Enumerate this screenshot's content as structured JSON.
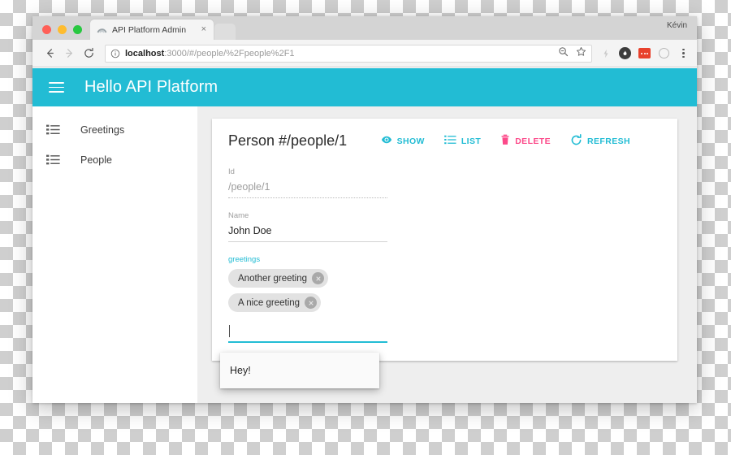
{
  "browser": {
    "profile_name": "Kévin",
    "tab": {
      "title": "API Platform Admin",
      "close_label": "×",
      "favicon": "rainbow-arc-icon"
    },
    "nav": {
      "back": "back-arrow-icon",
      "forward": "forward-arrow-icon",
      "reload": "reload-icon"
    },
    "omnibox": {
      "info_icon": "info-circle-icon",
      "host": "localhost",
      "path": ":3000/#/people/%2Fpeople%2F1",
      "full_url": "localhost:3000/#/people/%2Fpeople%2F1",
      "zoom_icon": "zoom-magnifier-icon",
      "bookmark_icon": "star-icon"
    },
    "extensions": [
      {
        "name": "lightning-icon"
      },
      {
        "name": "dark-circle-flame-icon"
      },
      {
        "name": "red-square-icon"
      },
      {
        "name": "gray-ring-icon"
      },
      {
        "name": "kebab-menu-icon"
      }
    ]
  },
  "app": {
    "header": {
      "menu_icon": "hamburger-menu-icon",
      "title": "Hello API Platform"
    },
    "sidebar": {
      "items": [
        {
          "label": "Greetings",
          "icon": "list-icon"
        },
        {
          "label": "People",
          "icon": "list-icon"
        }
      ]
    },
    "card": {
      "title": "Person #/people/1",
      "actions": [
        {
          "label": "SHOW",
          "icon": "eye-icon",
          "tone": "teal"
        },
        {
          "label": "LIST",
          "icon": "list-icon",
          "tone": "teal"
        },
        {
          "label": "DELETE",
          "icon": "trash-icon",
          "tone": "pink"
        },
        {
          "label": "REFRESH",
          "icon": "refresh-icon",
          "tone": "teal"
        }
      ],
      "fields": [
        {
          "label": "Id",
          "value": "/people/1",
          "state": "disabled"
        },
        {
          "label": "Name",
          "value": "John Doe",
          "state": "normal"
        }
      ],
      "chip_field": {
        "label": "greetings",
        "state": "focused",
        "chips": [
          {
            "text": "Another greeting",
            "remove_icon": "close-circle-icon"
          },
          {
            "text": "A nice greeting",
            "remove_icon": "close-circle-icon"
          }
        ],
        "input_value": "",
        "suggestions": [
          {
            "label": "Hey!"
          }
        ]
      },
      "save_button": {
        "label": ""
      }
    }
  },
  "colors": {
    "accent_teal": "#22bcd4",
    "danger_pink": "#fc4989",
    "canvas_gray": "#eeeeee",
    "chip_gray": "#e2e2e2"
  }
}
